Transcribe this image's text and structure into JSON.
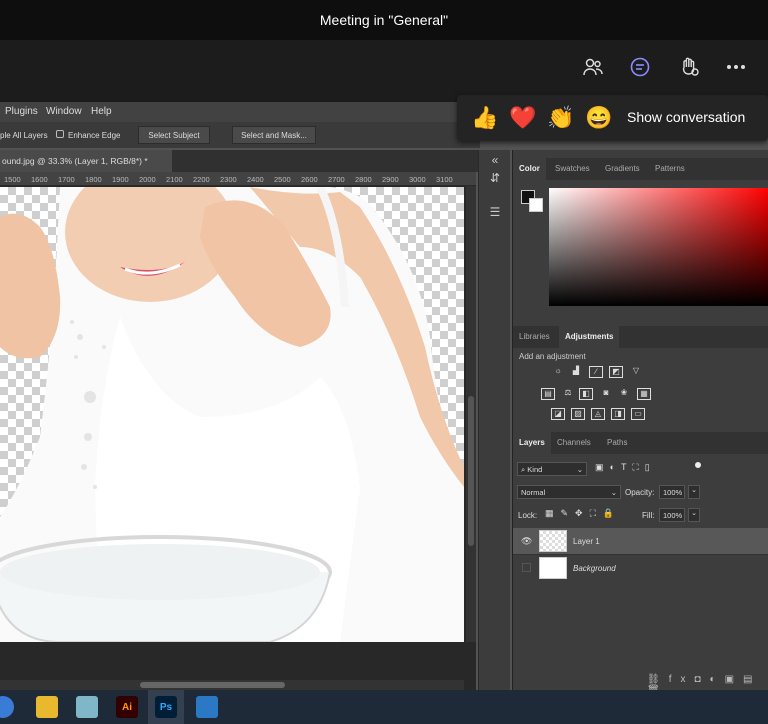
{
  "meeting": {
    "title": "Meeting in \"General\""
  },
  "header_icons": [
    "people-icon",
    "chat-icon",
    "raise-hand-icon",
    "more-icon"
  ],
  "reactions": {
    "items": [
      "👍",
      "❤️",
      "👏",
      "😄"
    ],
    "show_conversation": "Show conversation"
  },
  "photoshop": {
    "menu": [
      "Plugins",
      "Window",
      "Help"
    ],
    "options": {
      "sample_all_layers": "ple All Layers",
      "enhance_edge": "Enhance Edge",
      "select_subject": "Select Subject",
      "select_and_mask": "Select and Mask..."
    },
    "doc_tab": "ound.jpg @ 33.3% (Layer 1, RGB/8*) *",
    "ruler_ticks": [
      "1500",
      "1600",
      "1700",
      "1800",
      "1900",
      "2000",
      "2100",
      "2200",
      "2300",
      "2400",
      "2500",
      "2600",
      "2700",
      "2800",
      "2900",
      "3000",
      "3100"
    ],
    "color_tabs": [
      "Color",
      "Swatches",
      "Gradients",
      "Patterns"
    ],
    "adj_tabs": [
      "Libraries",
      "Adjustments"
    ],
    "add_adjustment": "Add an adjustment",
    "layers_tabs": [
      "Layers",
      "Channels",
      "Paths"
    ],
    "kind": "Kind",
    "blend_mode": "Normal",
    "opacity_label": "Opacity:",
    "opacity_value": "100%",
    "lock_label": "Lock:",
    "fill_label": "Fill:",
    "fill_value": "100%",
    "layers": [
      {
        "name": "Layer 1",
        "visible": true,
        "selected": true
      },
      {
        "name": "Background",
        "visible": false,
        "selected": false
      }
    ],
    "bottom_icons": "fx"
  },
  "taskbar": {
    "apps": [
      "File Explorer",
      "Notepad",
      "Ai",
      "Ps",
      "Photos"
    ]
  },
  "colors": {
    "accent_red": "#e0212e",
    "ps_panel": "#3d3d3d"
  }
}
